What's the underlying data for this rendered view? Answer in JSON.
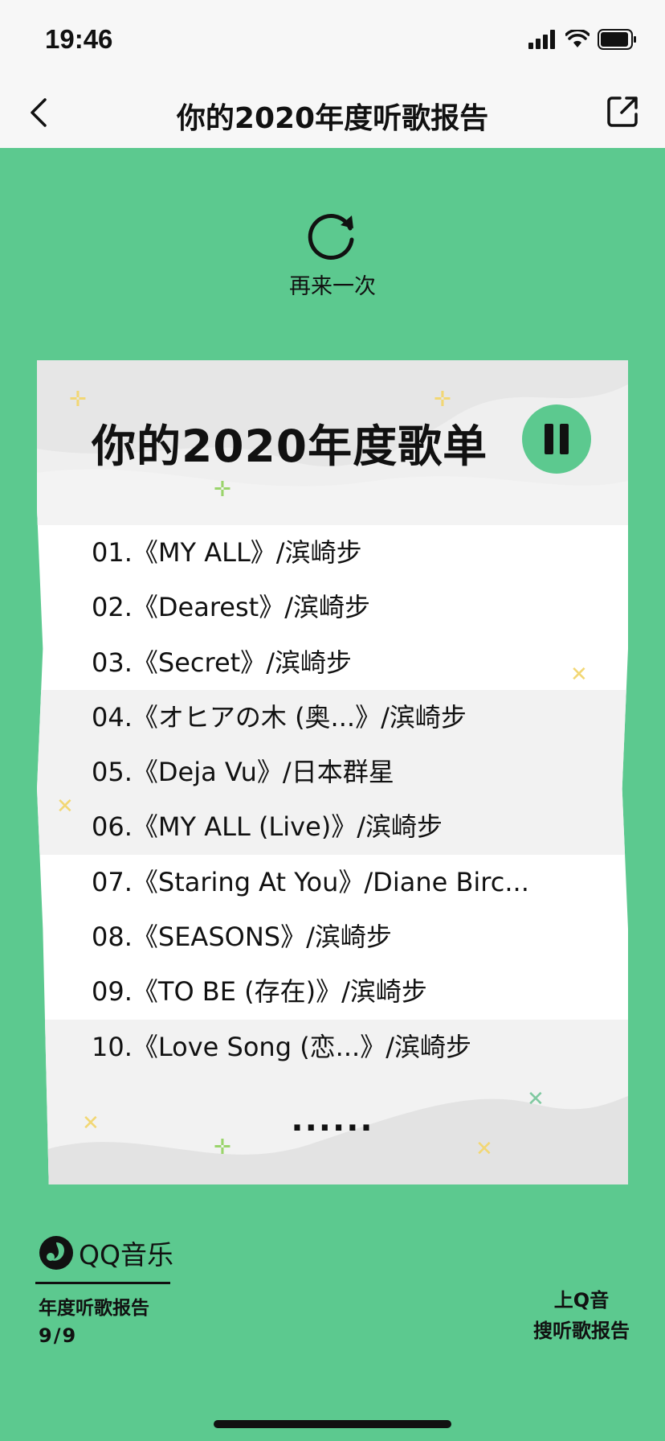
{
  "status_bar": {
    "time": "19:46"
  },
  "nav": {
    "title": "你的2020年度听歌报告"
  },
  "replay": {
    "label": "再来一次"
  },
  "card": {
    "title": "你的2020年度歌单",
    "songs": [
      {
        "num": "01.",
        "title": "《MY ALL》",
        "artist": "/滨崎步"
      },
      {
        "num": "02.",
        "title": "《Dearest》",
        "artist": "/滨崎步"
      },
      {
        "num": "03.",
        "title": "《Secret》",
        "artist": "/滨崎步"
      },
      {
        "num": "04.",
        "title": "《オヒアの木 (奥...》",
        "artist": "/滨崎步"
      },
      {
        "num": "05.",
        "title": "《Deja Vu》",
        "artist": "/日本群星"
      },
      {
        "num": "06.",
        "title": "《MY ALL (Live)》",
        "artist": "/滨崎步"
      },
      {
        "num": "07.",
        "title": "《Staring At You》",
        "artist": "/Diane Birc..."
      },
      {
        "num": "08.",
        "title": "《SEASONS》",
        "artist": "/滨崎步"
      },
      {
        "num": "09.",
        "title": "《TO BE (存在)》",
        "artist": "/滨崎步"
      },
      {
        "num": "10.",
        "title": "《Love Song (恋...》",
        "artist": "/滨崎步"
      }
    ],
    "more": "......"
  },
  "footer": {
    "brand_name": "QQ音乐",
    "report_label": "年度听歌报告",
    "page": "9/9",
    "search_tip_line1": "上Q音",
    "search_tip_line2": "搜听歌报告"
  },
  "colors": {
    "background": "#5cc98f",
    "accent": "#5cc98f",
    "card": "#ffffff",
    "card_band": "#f2f2f2"
  },
  "icons": [
    "back-chevron-icon",
    "share-icon",
    "replay-icon",
    "pause-icon",
    "qq-music-logo-icon",
    "signal-icon",
    "wifi-icon",
    "battery-icon"
  ]
}
